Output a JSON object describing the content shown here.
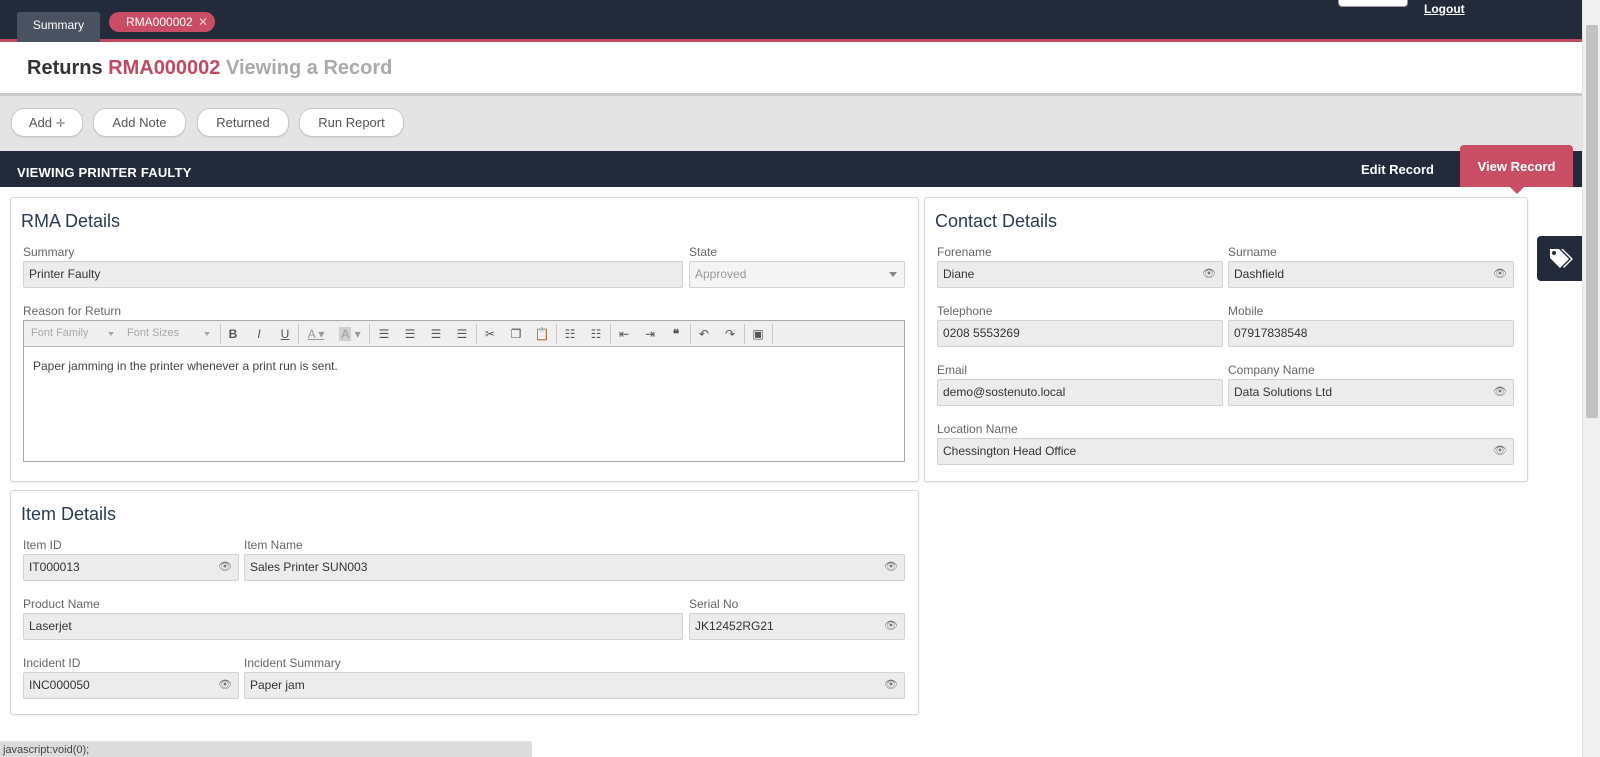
{
  "tabs": {
    "summary": "Summary",
    "rma": "RMA000002"
  },
  "header": {
    "logout": "Logout"
  },
  "title": {
    "part1": "Returns",
    "part2": "RMA000002",
    "part3": "Viewing a Record"
  },
  "toolbar": {
    "add": "Add",
    "add_note": "Add Note",
    "returned": "Returned",
    "run_report": "Run Report"
  },
  "section": {
    "title": "VIEWING PRINTER FAULTY",
    "edit_record": "Edit Record",
    "view_record": "View Record"
  },
  "rma": {
    "title": "RMA Details",
    "summary_label": "Summary",
    "summary_value": "Printer Faulty",
    "state_label": "State",
    "state_value": "Approved",
    "reason_label": "Reason for Return",
    "font_family": "Font Family",
    "font_sizes": "Font Sizes",
    "reason_text": "Paper jamming in the printer whenever a print run is sent."
  },
  "contact": {
    "title": "Contact Details",
    "forename_label": "Forename",
    "forename_value": "Diane",
    "surname_label": "Surname",
    "surname_value": "Dashfield",
    "telephone_label": "Telephone",
    "telephone_value": "0208 5553269",
    "mobile_label": "Mobile",
    "mobile_value": "07917838548",
    "email_label": "Email",
    "email_value": "demo@sostenuto.local",
    "company_label": "Company Name",
    "company_value": "Data Solutions Ltd",
    "location_label": "Location Name",
    "location_value": "Chessington Head Office"
  },
  "item": {
    "title": "Item Details",
    "item_id_label": "Item ID",
    "item_id_value": "IT000013",
    "item_name_label": "Item Name",
    "item_name_value": "Sales Printer SUN003",
    "product_label": "Product Name",
    "product_value": "Laserjet",
    "serial_label": "Serial No",
    "serial_value": "JK12452RG21",
    "incident_id_label": "Incident ID",
    "incident_id_value": "INC000050",
    "incident_summary_label": "Incident Summary",
    "incident_summary_value": "Paper jam"
  },
  "status_bar": "javascript:void(0);",
  "colors": {
    "navy": "#232b3a",
    "accent": "#c94d64"
  }
}
